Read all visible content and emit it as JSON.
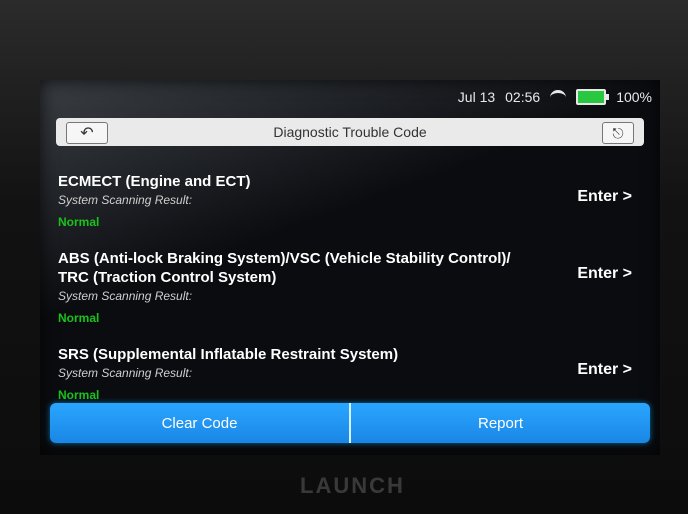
{
  "status": {
    "date": "Jul 13",
    "time": "02:56",
    "battery": "100%"
  },
  "header": {
    "title": "Diagnostic Trouble Code"
  },
  "systems": [
    {
      "name": "ECMECT (Engine and ECT)",
      "scan_label": "System Scanning Result:",
      "result": "Normal",
      "action": "Enter >"
    },
    {
      "name": "ABS (Anti-lock Braking System)/VSC (Vehicle Stability Control)/ TRC (Traction Control System)",
      "scan_label": "System Scanning Result:",
      "result": "Normal",
      "action": "Enter >"
    },
    {
      "name": "SRS (Supplemental Inflatable Restraint System)",
      "scan_label": "System Scanning Result:",
      "result": "Normal",
      "action": "Enter >"
    }
  ],
  "footer": {
    "clear_code": "Clear Code",
    "report": "Report"
  },
  "device": {
    "brand": "LAUNCH"
  },
  "colors": {
    "normal": "#17c41a",
    "accent": "#1a86e5"
  },
  "icons": [
    "back-icon",
    "exit-icon",
    "wifi-icon",
    "battery-icon"
  ]
}
